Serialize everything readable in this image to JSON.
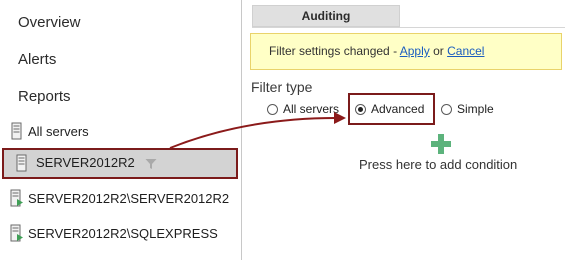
{
  "nav": {
    "overview": "Overview",
    "alerts": "Alerts",
    "reports": "Reports"
  },
  "tree": {
    "items": [
      {
        "label": "All servers",
        "icon": "server-icon"
      },
      {
        "label": "SERVER2012R2",
        "icon": "server-icon",
        "selected": true,
        "filter_icon": "filter-icon"
      },
      {
        "label": "SERVER2012R2\\SERVER2012R2",
        "icon": "server-instance-icon"
      },
      {
        "label": "SERVER2012R2\\SQLEXPRESS",
        "icon": "server-instance-icon"
      }
    ]
  },
  "tabs": [
    {
      "label": "Auditing",
      "active": true
    }
  ],
  "notification": {
    "text": "Filter settings changed - ",
    "apply_label": "Apply",
    "or_text": " or ",
    "cancel_label": "Cancel"
  },
  "filter": {
    "title": "Filter type",
    "options": [
      {
        "label": "All servers",
        "checked": false
      },
      {
        "label": "Advanced",
        "checked": true
      },
      {
        "label": "Simple",
        "checked": false
      }
    ]
  },
  "add_condition": {
    "icon": "plus-icon",
    "label": "Press here to add condition"
  },
  "colors": {
    "highlight_border": "#7b1b1b",
    "selected_bg": "#d3d3d3",
    "notify_bg": "#ffffc6",
    "link": "#1b5dbf",
    "add_icon": "#5cb37c"
  }
}
